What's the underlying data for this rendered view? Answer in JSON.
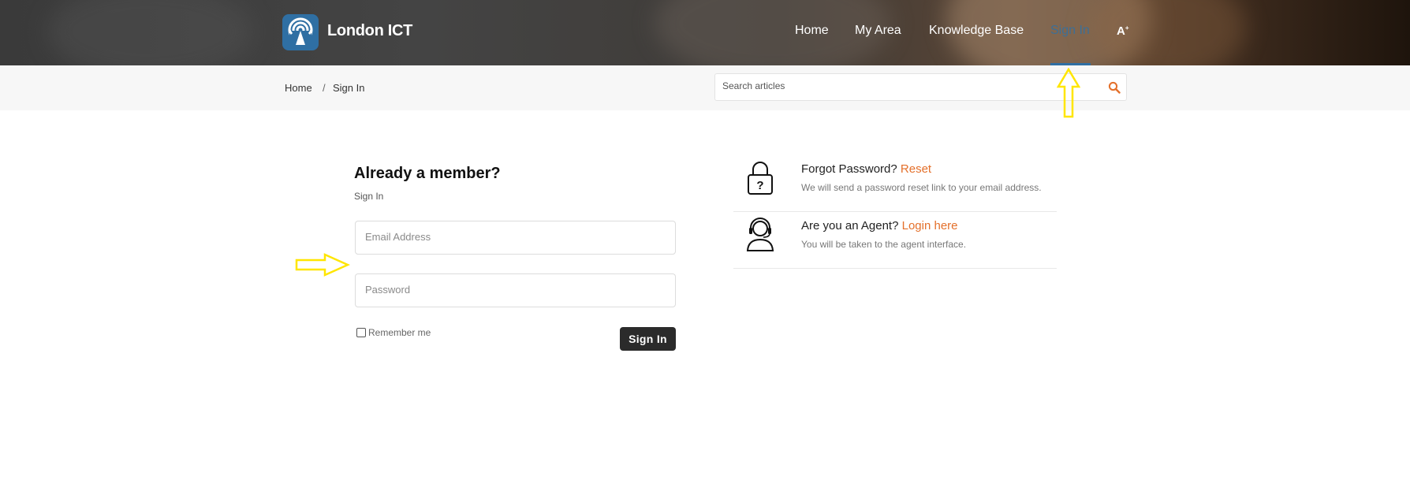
{
  "header": {
    "brand": "London ICT",
    "nav": [
      "Home",
      "My Area",
      "Knowledge Base",
      "Sign In"
    ],
    "active_nav": "Sign In",
    "font_size_icon": "A"
  },
  "breadcrumb": {
    "items": [
      "Home",
      "Sign In"
    ],
    "separator": "/"
  },
  "search": {
    "placeholder": "Search articles"
  },
  "login": {
    "title": "Already a member?",
    "subtitle": "Sign In",
    "email_placeholder": "Email Address",
    "password_placeholder": "Password",
    "remember_label": "Remember me",
    "submit_label": "Sign In"
  },
  "info": [
    {
      "question": "Forgot Password?",
      "link": "Reset",
      "description": "We will send a password reset link to your email address.",
      "icon": "lock-question-icon"
    },
    {
      "question": "Are you an Agent?",
      "link": "Login here",
      "description": "You will be taken to the agent interface.",
      "icon": "headset-agent-icon"
    }
  ],
  "colors": {
    "accent": "#e4702b",
    "brand_blue": "#2f6fa3",
    "active_nav": "#3d6f96",
    "annotation_arrow": "#ffe600"
  }
}
